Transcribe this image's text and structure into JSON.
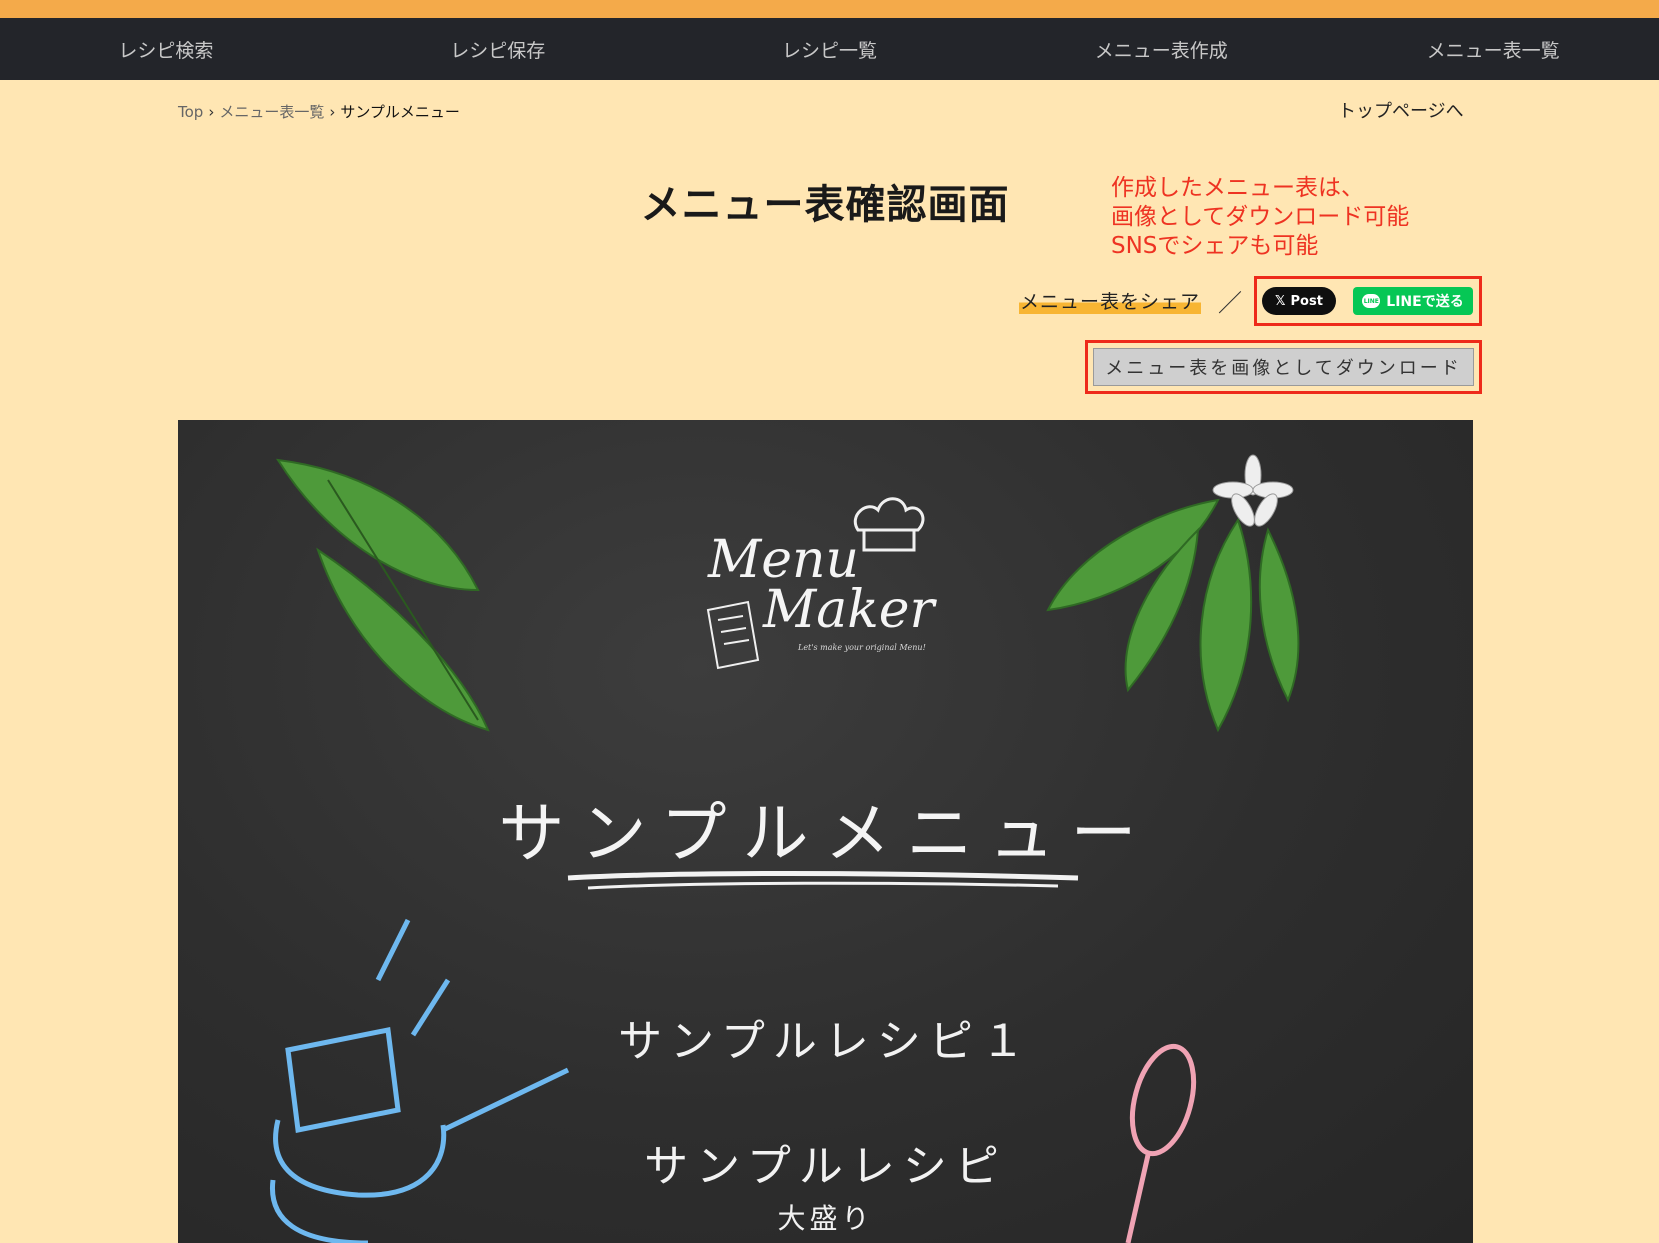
{
  "nav": {
    "items": [
      "レシピ検索",
      "レシピ保存",
      "レシピ一覧",
      "メニュー表作成",
      "メニュー表一覧"
    ]
  },
  "breadcrumb": {
    "top": "Top",
    "list": "メニュー表一覧",
    "current": "サンプルメニュー",
    "separator": "›"
  },
  "top_link": "トップページへ",
  "page_title": "メニュー表確認画面",
  "annotation": {
    "line1": "作成したメニュー表は、",
    "line2": "画像としてダウンロード可能",
    "line3": "SNSでシェアも可能"
  },
  "share": {
    "label": "メニュー表をシェア",
    "slash": "／",
    "x_label": "Post",
    "x_icon": "𝕏",
    "line_label": "LINEで送る",
    "line_icon_text": "LINE"
  },
  "download_label": "メニュー表を画像としてダウンロード",
  "menu_image": {
    "logo_line1": "Menu",
    "logo_line2": "Maker",
    "logo_tagline": "Let's make your original Menu!",
    "title": "サンプルメニュー",
    "recipes": [
      "サンプルレシピ１",
      "サンプルレシピ"
    ],
    "recipe2_note": "大盛り"
  },
  "colors": {
    "accent_orange": "#f4aa4a",
    "navbar": "#23252a",
    "page_background": "#ffe6b3",
    "annotation_red": "#ee3322",
    "line_green": "#06c755",
    "chalkboard": "#2e2e2e"
  }
}
